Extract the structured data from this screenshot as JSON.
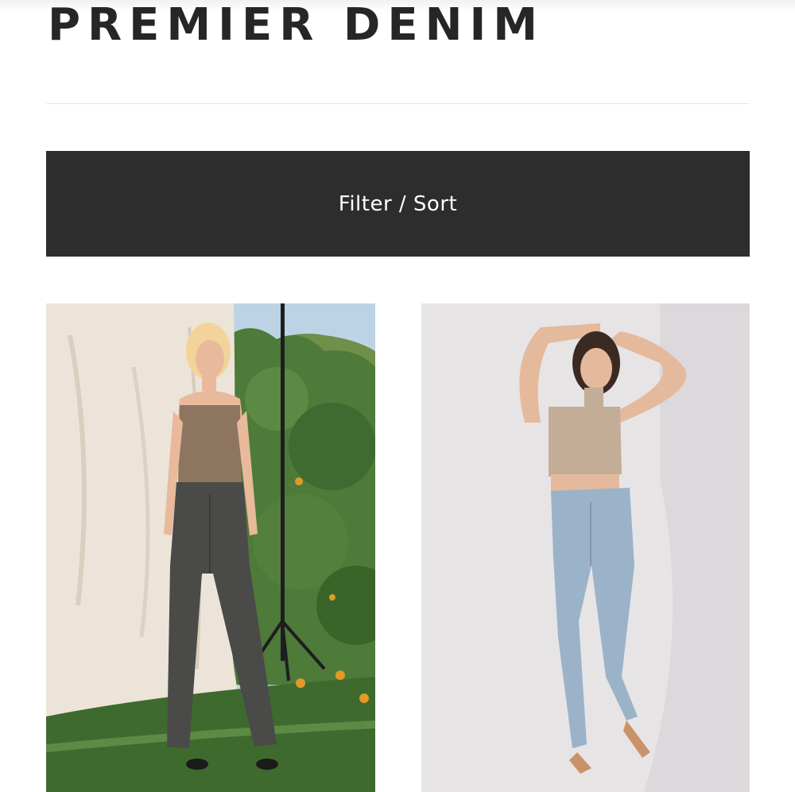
{
  "header": {
    "title": "PREMIER DENIM"
  },
  "toolbar": {
    "filter_sort_label": "Filter / Sort"
  },
  "products": [
    {
      "image": "product-photo",
      "scene": "outdoor-garden",
      "colors": {
        "backdrop": "#ece4d8",
        "foliage": "#4e7a3a",
        "grass": "#3f6a2e",
        "jeans": "#4a4a48",
        "top": "#8d7560"
      }
    },
    {
      "image": "product-photo",
      "scene": "studio",
      "colors": {
        "backdrop": "#e7e4e6",
        "jeans": "#9bb3c9",
        "top": "#c4ad96"
      }
    }
  ],
  "colors": {
    "accent": "#2d2d2d",
    "title": "#262626",
    "divider": "#e6e6e6"
  }
}
